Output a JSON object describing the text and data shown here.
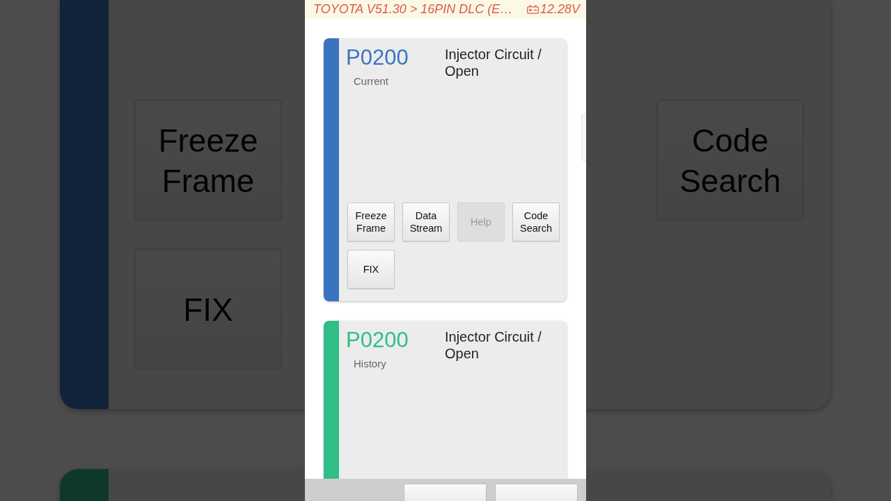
{
  "backdrop": {
    "button_rows": [
      [
        {
          "label": "Freeze Frame"
        },
        {
          "label": "Code Search"
        }
      ],
      [
        {
          "label": "FIX"
        }
      ]
    ]
  },
  "header": {
    "title": "TOYOTA V51.30 > 16PIN DLC (E…",
    "voltage": "12.28V"
  },
  "cards": [
    {
      "code": "P0200",
      "status": "Current",
      "description": "Injector Circuit / Open",
      "color": "#3a74c0",
      "buttons": [
        {
          "label": "Freeze Frame",
          "disabled": false
        },
        {
          "label": "Data Stream",
          "disabled": false
        },
        {
          "label": "Help",
          "disabled": true
        },
        {
          "label": "Code Search",
          "disabled": false
        },
        {
          "label": "FIX",
          "disabled": false
        }
      ]
    },
    {
      "code": "P0200",
      "status": "History",
      "description": "Injector Circuit / Open",
      "color": "#2fbf86"
    }
  ],
  "footer": {
    "buttons": [
      {
        "disabled": false
      },
      {
        "disabled": false
      }
    ]
  }
}
